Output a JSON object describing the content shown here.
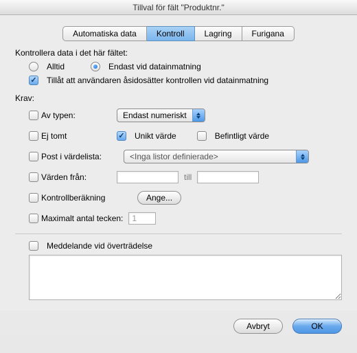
{
  "title": "Tillval för fält \"Produktnr.\"",
  "tabs": [
    {
      "label": "Automatiska data"
    },
    {
      "label": "Kontroll"
    },
    {
      "label": "Lagring"
    },
    {
      "label": "Furigana"
    }
  ],
  "validate": {
    "heading": "Kontrollera data i det här fältet:",
    "always": "Alltid",
    "only_on_entry": "Endast vid datainmatning",
    "allow_override": "Tillåt att användaren åsidosätter kontrollen vid datainmatning"
  },
  "requirements": {
    "heading": "Krav:",
    "of_type_label": "Av typen:",
    "of_type_value": "Endast numeriskt",
    "not_empty": "Ej tomt",
    "unique": "Unikt värde",
    "existing": "Befintligt värde",
    "in_value_list_label": "Post i värdelista:",
    "in_value_list_value": "<Inga listor definierade>",
    "range_label": "Värden från:",
    "range_from": "",
    "range_to_label": "till",
    "range_to": "",
    "calc_label": "Kontrollberäkning",
    "calc_button": "Ange...",
    "max_chars_label": "Maximalt antal tecken:",
    "max_chars_value": "1",
    "message_label": "Meddelande vid överträdelse",
    "message_value": ""
  },
  "buttons": {
    "cancel": "Avbryt",
    "ok": "OK"
  }
}
